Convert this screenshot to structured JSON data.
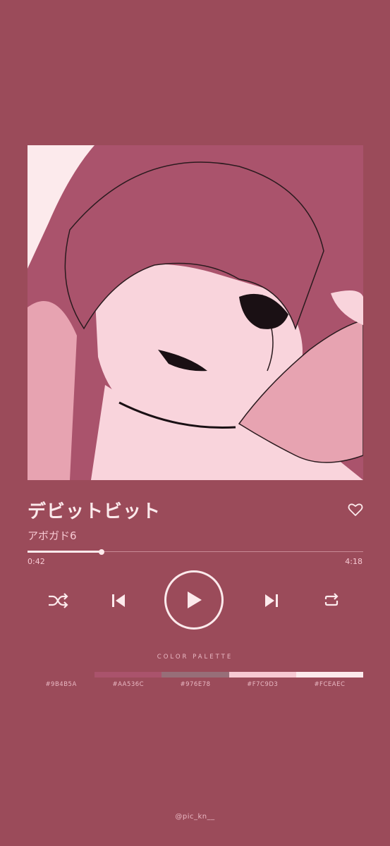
{
  "track": {
    "title": "デビットビット",
    "artist": "アボガド6",
    "elapsed": "0:42",
    "total": "4:18",
    "progress": 0.22
  },
  "icons": {
    "like": "heart-icon",
    "shuffle": "shuffle-icon",
    "previous": "skip-previous-icon",
    "play": "play-icon",
    "next": "skip-next-icon",
    "repeat": "repeat-icon"
  },
  "palette": {
    "label": "COLOR PALETTE",
    "colors": [
      "#9B4B5A",
      "#AA536C",
      "#976E78",
      "#F7C9D3",
      "#FCEAEC"
    ],
    "codes": [
      "#9B4B5A",
      "#AA536C",
      "#976E78",
      "#F7C9D3",
      "#FCEAEC"
    ]
  },
  "credit": "@pic_kn__"
}
